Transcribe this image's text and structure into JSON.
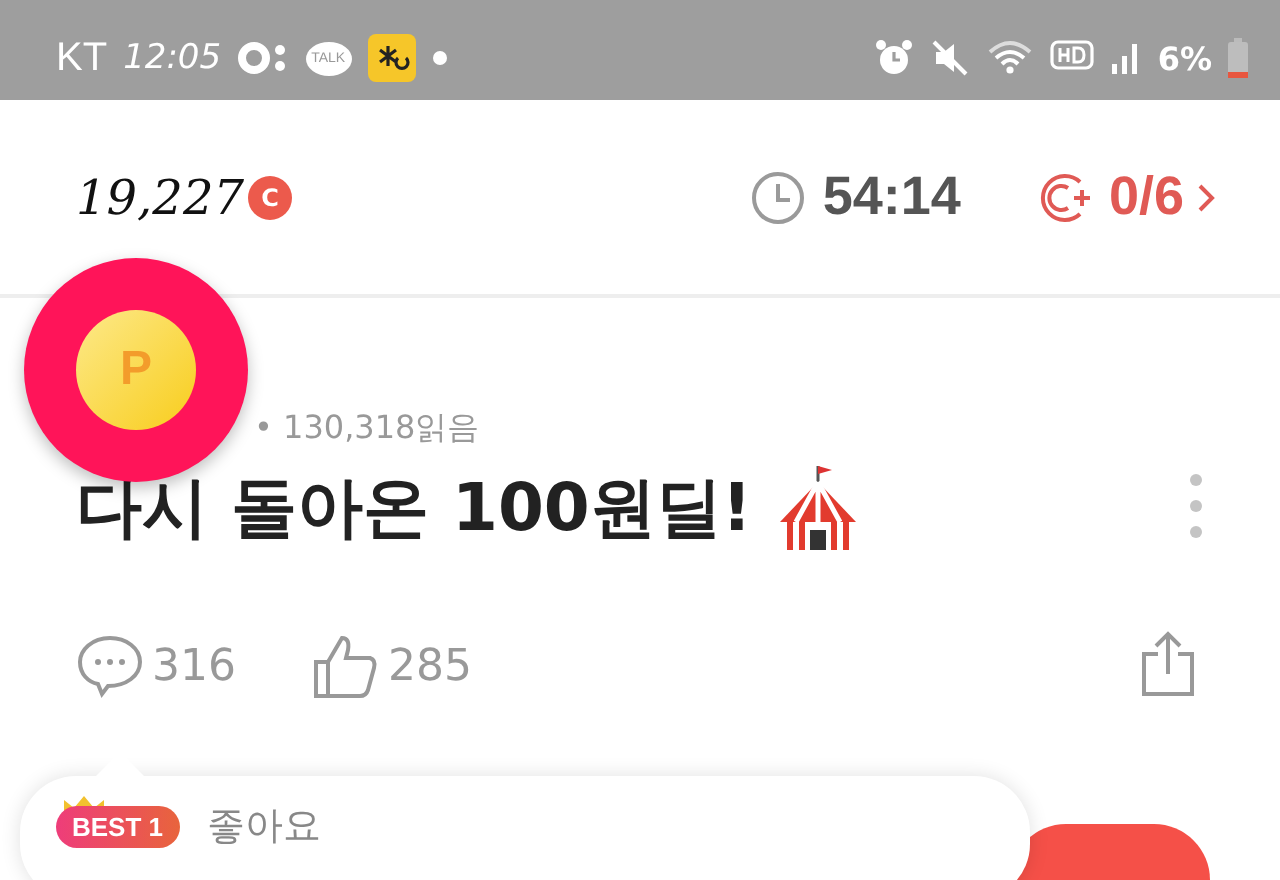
{
  "status_bar": {
    "carrier": "KT",
    "time": "12:05",
    "talk_label": "TALK",
    "battery": "6%"
  },
  "header": {
    "points": "19,227",
    "points_badge": "C",
    "timer": "54:14",
    "missions": "0/6"
  },
  "floating_button": {
    "label": "P"
  },
  "post": {
    "meta": "• 130,318읽음",
    "title": "다시 돌아온 100원딜!",
    "comments": "316",
    "likes": "285"
  },
  "best_comment": {
    "badge": "BEST 1",
    "text": "좋아요"
  }
}
